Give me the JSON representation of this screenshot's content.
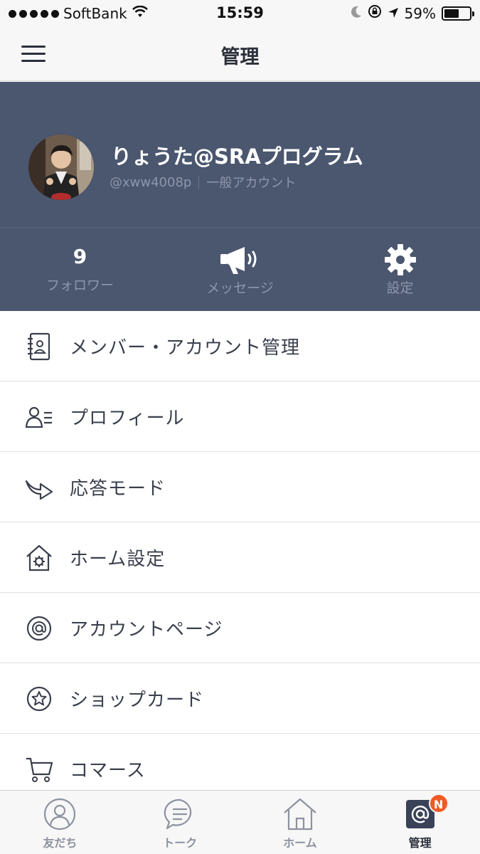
{
  "status_bar": {
    "carrier": "SoftBank",
    "time": "15:59",
    "battery_percent": "59%",
    "battery_level": 0.59,
    "icons": [
      "signal-dots-icon",
      "wifi-icon",
      "moon-icon",
      "orientation-lock-icon",
      "location-arrow-icon",
      "battery-icon"
    ]
  },
  "nav": {
    "title": "管理",
    "menu_icon": "hamburger-icon"
  },
  "profile": {
    "name": "りょうた@SRAプログラム",
    "handle": "@xww4008p",
    "account_type": "一般アカウント",
    "stats": [
      {
        "value": "9",
        "label": "フォロワー"
      },
      {
        "icon": "megaphone-icon",
        "label": "メッセージ"
      },
      {
        "icon": "gear-icon",
        "label": "設定"
      }
    ]
  },
  "menu": {
    "items": [
      {
        "label": "メンバー・アカウント管理",
        "icon": "address-book-icon"
      },
      {
        "label": "プロフィール",
        "icon": "profile-card-icon"
      },
      {
        "label": "応答モード",
        "icon": "reply-arrow-icon"
      },
      {
        "label": "ホーム設定",
        "icon": "home-gear-icon"
      },
      {
        "label": "アカウントページ",
        "icon": "at-circle-icon"
      },
      {
        "label": "ショップカード",
        "icon": "star-circle-icon"
      },
      {
        "label": "コマース",
        "icon": "cart-icon"
      }
    ]
  },
  "tabbar": {
    "tabs": [
      {
        "label": "友だち",
        "icon": "person-icon"
      },
      {
        "label": "トーク",
        "icon": "chat-bubble-icon"
      },
      {
        "label": "ホーム",
        "icon": "house-icon"
      },
      {
        "label": "管理",
        "icon": "at-square-icon",
        "badge": "N",
        "active": true
      }
    ]
  },
  "colors": {
    "header_bg": "#4b566f",
    "badge": "#f15a24",
    "text": "#3a3f4c"
  }
}
